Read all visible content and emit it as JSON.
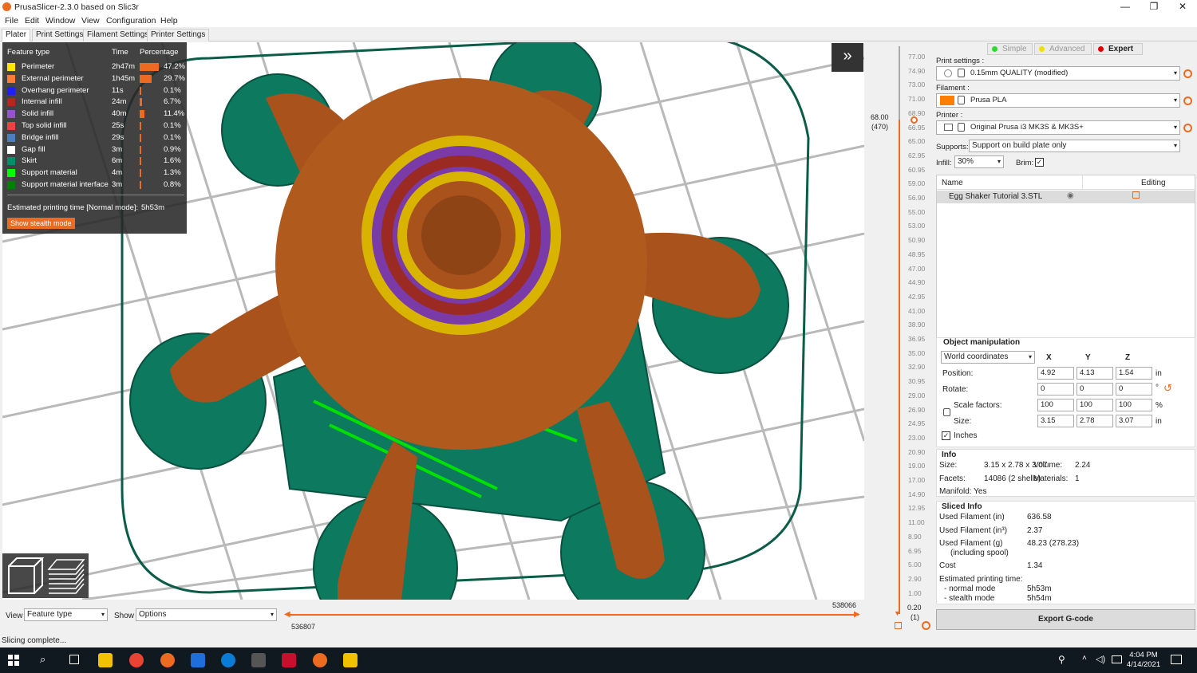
{
  "window": {
    "title": "PrusaSlicer-2.3.0 based on Slic3r",
    "minimize": "—",
    "maximize": "❐",
    "close": "✕"
  },
  "menu": [
    "File",
    "Edit",
    "Window",
    "View",
    "Configuration",
    "Help"
  ],
  "tabs": [
    "Plater",
    "Print Settings",
    "Filament Settings",
    "Printer Settings"
  ],
  "legend": {
    "headers": [
      "Feature type",
      "Time",
      "Percentage"
    ],
    "rows": [
      {
        "name": "Perimeter",
        "time": "2h47m",
        "pct": "47.2%",
        "color": "#ffe600",
        "frac": 0.472
      },
      {
        "name": "External perimeter",
        "time": "1h45m",
        "pct": "29.7%",
        "color": "#ff7d38",
        "frac": 0.297
      },
      {
        "name": "Overhang perimeter",
        "time": "11s",
        "pct": "0.1%",
        "color": "#1f1fff",
        "frac": 0.001
      },
      {
        "name": "Internal infill",
        "time": "24m",
        "pct": "6.7%",
        "color": "#b3271c",
        "frac": 0.067
      },
      {
        "name": "Solid infill",
        "time": "40m",
        "pct": "11.4%",
        "color": "#9654cc",
        "frac": 0.114
      },
      {
        "name": "Top solid infill",
        "time": "25s",
        "pct": "0.1%",
        "color": "#f04040",
        "frac": 0.001
      },
      {
        "name": "Bridge infill",
        "time": "29s",
        "pct": "0.1%",
        "color": "#4d80ba",
        "frac": 0.001
      },
      {
        "name": "Gap fill",
        "time": "3m",
        "pct": "0.9%",
        "color": "#ffffff",
        "frac": 0.009
      },
      {
        "name": "Skirt",
        "time": "6m",
        "pct": "1.6%",
        "color": "#008f6b",
        "frac": 0.016
      },
      {
        "name": "Support material",
        "time": "4m",
        "pct": "1.3%",
        "color": "#00ff00",
        "frac": 0.013
      },
      {
        "name": "Support material interface",
        "time": "3m",
        "pct": "0.8%",
        "color": "#008000",
        "frac": 0.008
      }
    ],
    "estimated": "Estimated printing time [Normal mode]:",
    "estimated_value": "5h53m",
    "stealth_button": "Show stealth mode"
  },
  "collapse_icon": "»",
  "bottom": {
    "view_label": "View",
    "view_value": "Feature type",
    "show_label": "Show",
    "show_value": "Options",
    "hslider_right": "538066",
    "hslider_left": "536807"
  },
  "vslider": {
    "ticks": [
      "77.00",
      "74.90",
      "73.00",
      "71.00",
      "68.90",
      "66.95",
      "65.00",
      "62.95",
      "60.95",
      "59.00",
      "56.90",
      "55.00",
      "53.00",
      "50.90",
      "48.95",
      "47.00",
      "44.90",
      "42.95",
      "41.00",
      "38.90",
      "36.95",
      "35.00",
      "32.90",
      "30.95",
      "29.00",
      "26.90",
      "24.95",
      "23.00",
      "20.90",
      "19.00",
      "17.00",
      "14.90",
      "12.95",
      "11.00",
      "8.90",
      "6.95",
      "5.00",
      "2.90",
      "1.00"
    ],
    "top_value": "68.00",
    "top_layer": "(470)",
    "bottom_value": "0.20",
    "bottom_layer": "(1)"
  },
  "modes": [
    "Simple",
    "Advanced",
    "Expert"
  ],
  "right": {
    "print_settings_label": "Print settings :",
    "print_settings": "0.15mm QUALITY (modified)",
    "filament_label": "Filament :",
    "filament": "Prusa PLA",
    "printer_label": "Printer :",
    "printer": "Original Prusa i3 MK3S & MK3S+",
    "supports_label": "Supports:",
    "supports": "Support on build plate only",
    "infill_label": "Infill:",
    "infill": "30%",
    "brim_label": "Brim:",
    "list_headers": [
      "Name",
      "Editing"
    ],
    "object_name": "Egg Shaker Tutorial 3.STL"
  },
  "manip": {
    "title": "Object manipulation",
    "coords": "World coordinates",
    "axes": [
      "X",
      "Y",
      "Z"
    ],
    "position_label": "Position:",
    "position": [
      "4.92",
      "4.13",
      "1.54"
    ],
    "position_unit": "in",
    "rotate_label": "Rotate:",
    "rotate": [
      "0",
      "0",
      "0"
    ],
    "rotate_unit": "°",
    "scale_label": "Scale factors:",
    "scale": [
      "100",
      "100",
      "100"
    ],
    "scale_unit": "%",
    "size_label": "Size:",
    "size": [
      "3.15",
      "2.78",
      "3.07"
    ],
    "size_unit": "in",
    "inches": "Inches"
  },
  "info": {
    "title": "Info",
    "size_label": "Size:",
    "size": "3.15 x 2.78 x 3.07",
    "volume_label": "Volume:",
    "volume": "2.24",
    "facets_label": "Facets:",
    "facets": "14086 (2 shells)",
    "materials_label": "Materials:",
    "materials": "1",
    "manifold": "Manifold: Yes"
  },
  "sliced": {
    "title": "Sliced Info",
    "rows": [
      {
        "label": "Used Filament (in)",
        "value": "636.58"
      },
      {
        "label": "Used Filament (in³)",
        "value": "2.37"
      },
      {
        "label": "Used Filament (g)",
        "value": "48.23 (278.23)"
      },
      {
        "label": "(including spool)",
        "value": ""
      },
      {
        "label": "Cost",
        "value": "1.34"
      },
      {
        "label": "Estimated printing time:",
        "value": ""
      },
      {
        "label": "- normal mode",
        "value": "5h53m"
      },
      {
        "label": "- stealth mode",
        "value": "5h54m"
      }
    ]
  },
  "export": "Export G-code",
  "status": "Slicing complete...",
  "clock": {
    "time": "4:04 PM",
    "date": "4/14/2021"
  }
}
